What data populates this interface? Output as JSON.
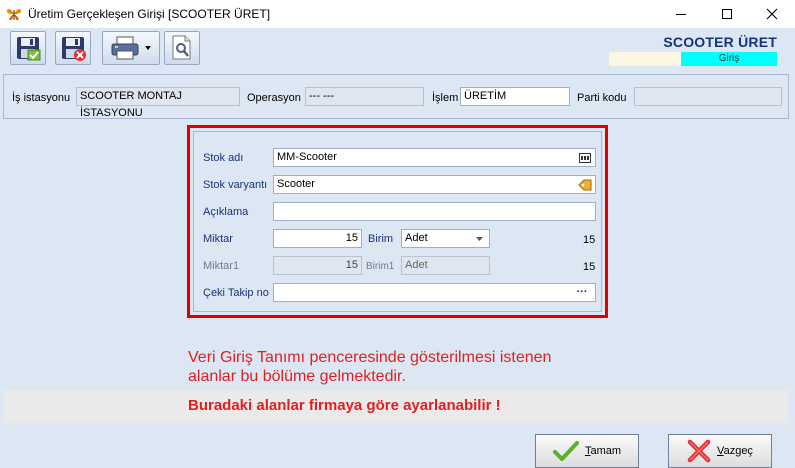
{
  "window": {
    "title": "Üretim Gerçekleşen Girişi [SCOOTER ÜRET]"
  },
  "brand": {
    "title": "SCOOTER ÜRET",
    "subtitle": "Giriş"
  },
  "header": {
    "station_label": "İş istasyonu",
    "station_value": "SCOOTER MONTAJ İSTASYONU",
    "operation_label": "Operasyon",
    "operation_value": "--- ---",
    "process_label": "İşlem",
    "process_value": "ÜRETİM",
    "batch_label": "Parti kodu",
    "batch_value": ""
  },
  "form": {
    "stock_name_label": "Stok adı",
    "stock_name_value": "MM-Scooter",
    "stock_variant_label": "Stok varyantı",
    "stock_variant_value": "Scooter",
    "description_label": "Açıklama",
    "description_value": "",
    "quantity_label": "Miktar",
    "quantity_value": "15",
    "unit_label": "Birim",
    "unit_value": "Adet",
    "quantity_total": "15",
    "quantity1_label": "Miktar1",
    "quantity1_value": "15",
    "unit1_label": "Birim1",
    "unit1_value": "Adet",
    "quantity1_total": "15",
    "check_tracking_label": "Çeki Takip no",
    "check_tracking_value": "",
    "ellipsis": "···"
  },
  "notes": {
    "line1": "Veri Giriş Tanımı penceresinde gösterilmesi istenen",
    "line2": "alanlar bu bölüme gelmektedir.",
    "warning": "Buradaki alanlar firmaya göre ayarlanabilir !"
  },
  "actions": {
    "ok_mnemonic": "T",
    "ok_rest": "amam",
    "cancel_mnemonic": "V",
    "cancel_rest": "azgeç"
  },
  "colors": {
    "background": "#dde7f3",
    "highlight_border": "#e00000",
    "brand_text": "#15337a",
    "brand_accent": "#00ffff",
    "note_text": "#e02020"
  }
}
